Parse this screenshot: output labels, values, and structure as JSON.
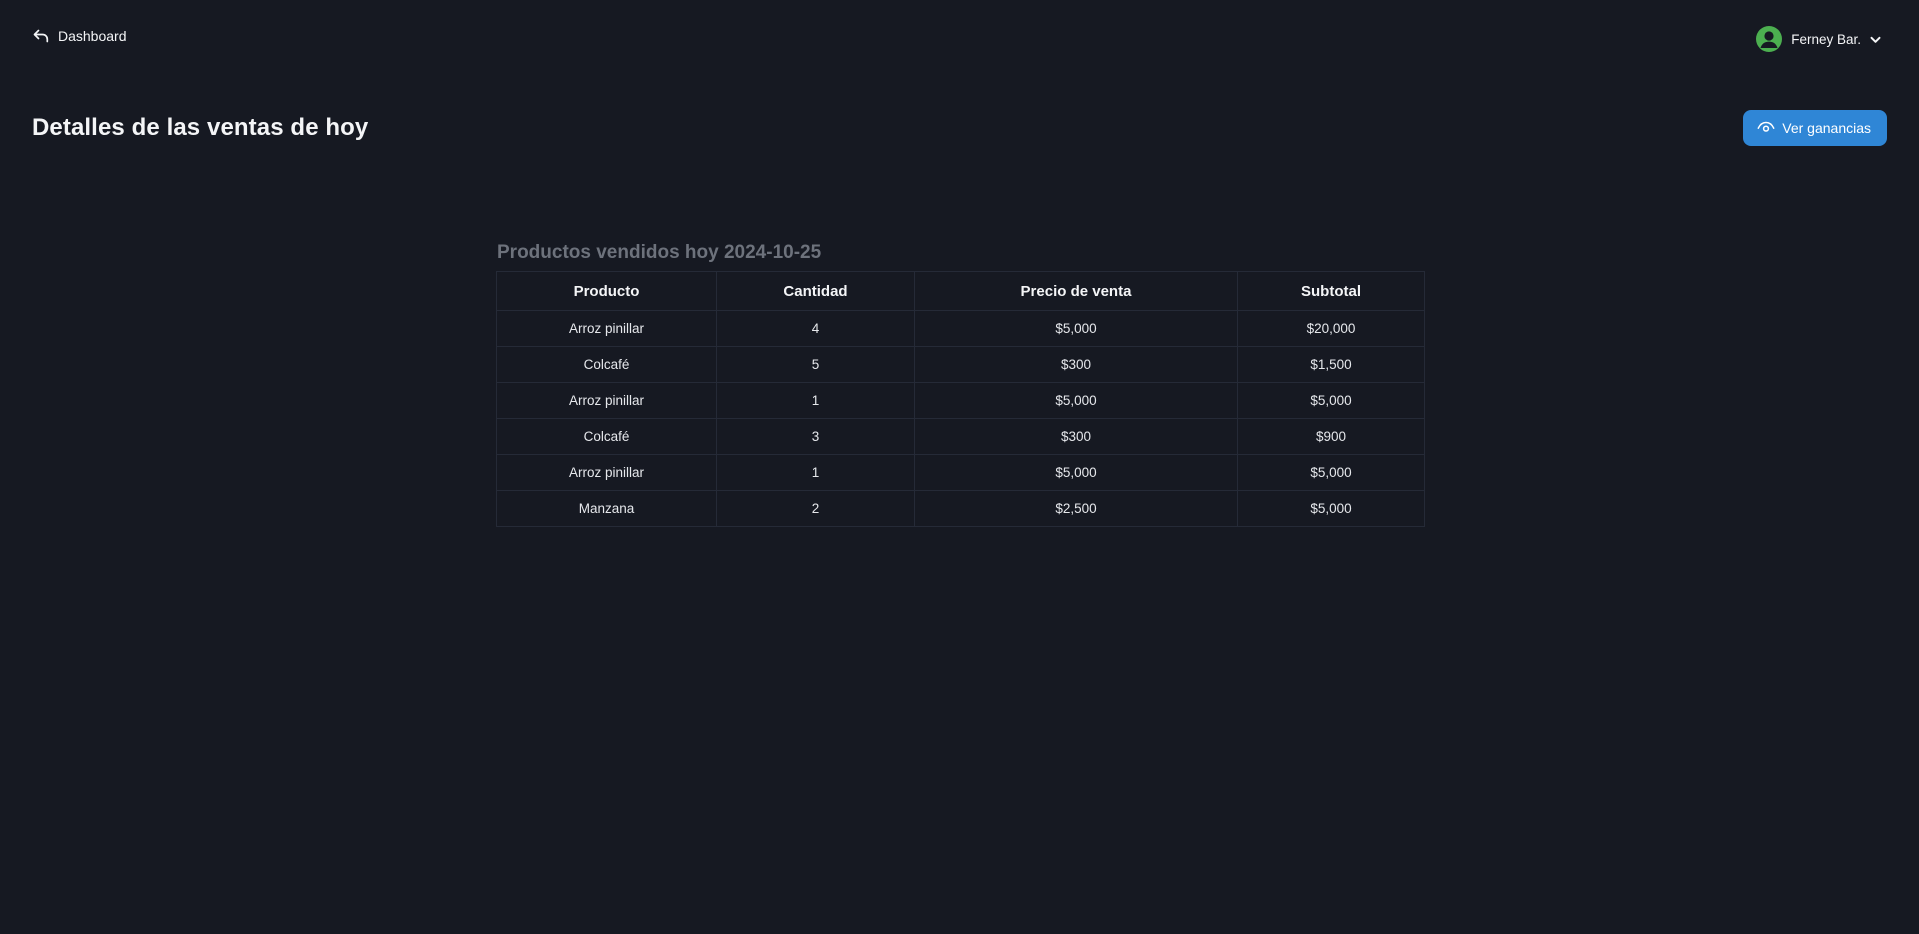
{
  "header": {
    "back_label": "Dashboard",
    "user_name": "Ferney Bar."
  },
  "page": {
    "title": "Detalles de las ventas de hoy",
    "action_button_label": "Ver ganancias"
  },
  "sales": {
    "title": "Productos vendidos hoy 2024-10-25",
    "columns": [
      "Producto",
      "Cantidad",
      "Precio de venta",
      "Subtotal"
    ],
    "rows": [
      [
        "Arroz pinillar",
        "4",
        "$5,000",
        "$20,000"
      ],
      [
        "Colcafé",
        "5",
        "$300",
        "$1,500"
      ],
      [
        "Arroz pinillar",
        "1",
        "$5,000",
        "$5,000"
      ],
      [
        "Colcafé",
        "3",
        "$300",
        "$900"
      ],
      [
        "Arroz pinillar",
        "1",
        "$5,000",
        "$5,000"
      ],
      [
        "Manzana",
        "2",
        "$2,500",
        "$5,000"
      ]
    ]
  },
  "icons": {
    "back": "undo-arrow-icon",
    "user": "user-avatar-icon",
    "dropdown": "chevron-down-icon",
    "button": "eye-icon"
  },
  "colors": {
    "background": "#161922",
    "accent": "#2f86d6",
    "avatar": "#4caf50",
    "muted_title": "#6d727c",
    "table_border": "#252a37"
  }
}
